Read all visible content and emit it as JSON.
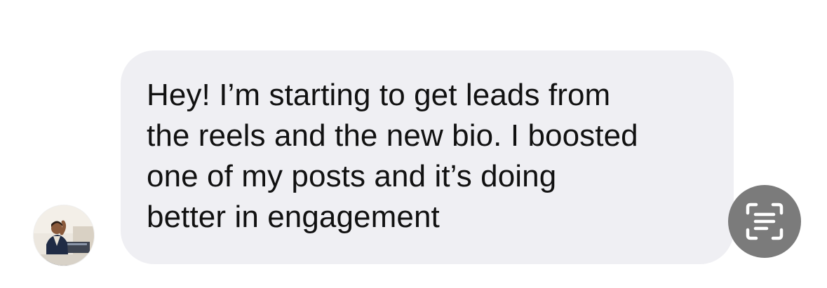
{
  "message": {
    "text": "Hey! I’m starting to get leads from\nthe reels and the new bio. I boosted\none of my posts and it’s doing\nbetter in engagement"
  },
  "sender": {
    "avatar_icon": "profile-photo"
  },
  "actions": {
    "live_text_icon": "text-scan-icon"
  },
  "colors": {
    "bubble": "#efeff3",
    "text": "#111111",
    "live_text_button": "#7b7b7b"
  }
}
